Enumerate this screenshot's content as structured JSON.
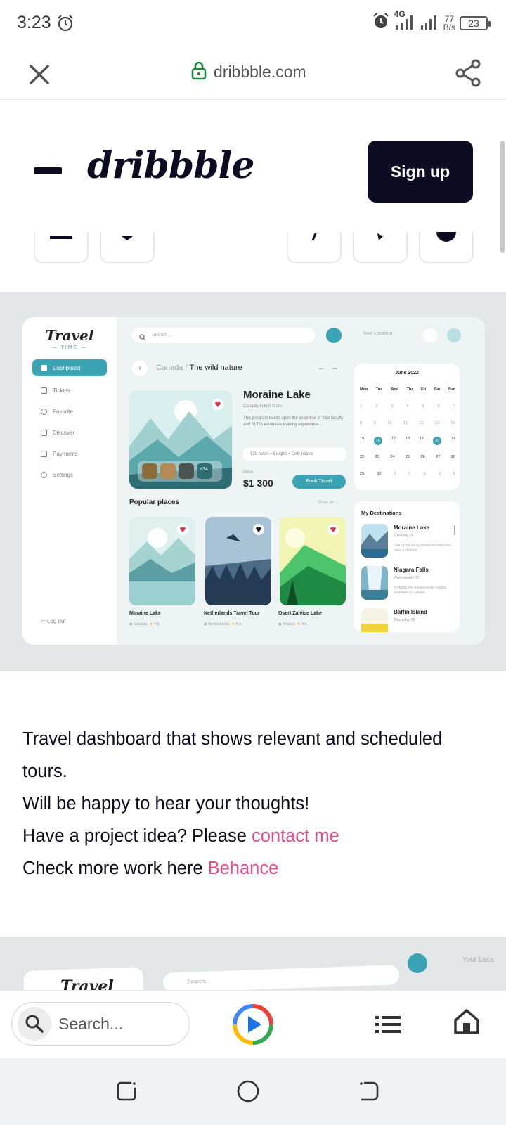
{
  "status_bar": {
    "time": "3:23",
    "network_type": "4G",
    "speed_value": "77",
    "speed_unit": "B/s",
    "battery": "23"
  },
  "browser": {
    "url": "dribbble.com",
    "icons": [
      "close-icon",
      "lock-icon",
      "share-icon"
    ]
  },
  "site_header": {
    "logo": "dribbble",
    "signup_label": "Sign up"
  },
  "shot": {
    "brand": "Travel",
    "brand_sub": "TIME",
    "sidebar": [
      {
        "label": "Dashboard",
        "active": true
      },
      {
        "label": "Tickets",
        "active": false
      },
      {
        "label": "Favorite",
        "active": false
      },
      {
        "label": "Discover",
        "active": false
      },
      {
        "label": "Payments",
        "active": false
      },
      {
        "label": "Settings",
        "active": false
      }
    ],
    "logout": "Log out",
    "search_placeholder": "Search...",
    "location_placeholder": "Your Location",
    "breadcrumb_parent": "Canada",
    "breadcrumb_current": "The wild nature",
    "place_title": "Moraine Lake",
    "place_location": "Canada,Yukon State",
    "place_description": "This program builds upon the expertise of Yale faculty and ELTI's extensive training experience...",
    "chips": "120 hours  •  5 nights  •  Only nature",
    "price_label": "Price",
    "price": "$1 300",
    "book_label": "Book Travel",
    "hero_more": "+34",
    "calendar": {
      "title": "June 2022",
      "weekdays": [
        "Mon",
        "Tue",
        "Wed",
        "Thr",
        "Fri",
        "Sat",
        "Sun"
      ],
      "weeks": [
        [
          "1",
          "2",
          "3",
          "4",
          "5",
          "6",
          "7"
        ],
        [
          "8",
          "9",
          "10",
          "11",
          "12",
          "13",
          "14"
        ],
        [
          "15",
          "16",
          "17",
          "18",
          "19",
          "20",
          "21"
        ],
        [
          "22",
          "23",
          "24",
          "25",
          "26",
          "27",
          "28"
        ],
        [
          "29",
          "30",
          "1",
          "2",
          "3",
          "4",
          "5"
        ]
      ],
      "selected_start": "16",
      "selected_end": "20"
    },
    "popular_title": "Popular places",
    "show_all": "Show all →",
    "popular": [
      {
        "name": "Moraine Lake",
        "country": "Canada",
        "rating": "4.6"
      },
      {
        "name": "Netherlands Travel Tour",
        "country": "Netherlands",
        "rating": "4.6"
      },
      {
        "name": "Osert Zalvice Lake",
        "country": "Poland",
        "rating": "4.6"
      }
    ],
    "destinations_title": "My Destinations",
    "destinations": [
      {
        "name": "Moraine Lake",
        "date": "Tuesday 16",
        "desc": "One of the many wonderful turquoise lakes in Alberta."
      },
      {
        "name": "Niagara Falls",
        "date": "Wednesday 17",
        "desc": "Probably the most popular natural landmark in Canada"
      },
      {
        "name": "Baffin Island",
        "date": "Thursday 18",
        "desc": ""
      }
    ]
  },
  "description": {
    "line1": "Travel dashboard that shows relevant and scheduled tours.",
    "line2": "Will be happy to hear your thoughts!",
    "line3_prefix": "Have a project idea? Please ",
    "line3_link": "contact me",
    "line4_prefix": "Check more work here ",
    "line4_link": "Behance"
  },
  "next_shot": {
    "brand": "Travel",
    "search_placeholder": "Search...",
    "location_placeholder": "Your Loca"
  },
  "bottom_toolbar": {
    "search_placeholder": "Search..."
  },
  "colors": {
    "accent": "#3aa4b4",
    "link": "#ea4c89",
    "dark": "#0d0c22"
  }
}
